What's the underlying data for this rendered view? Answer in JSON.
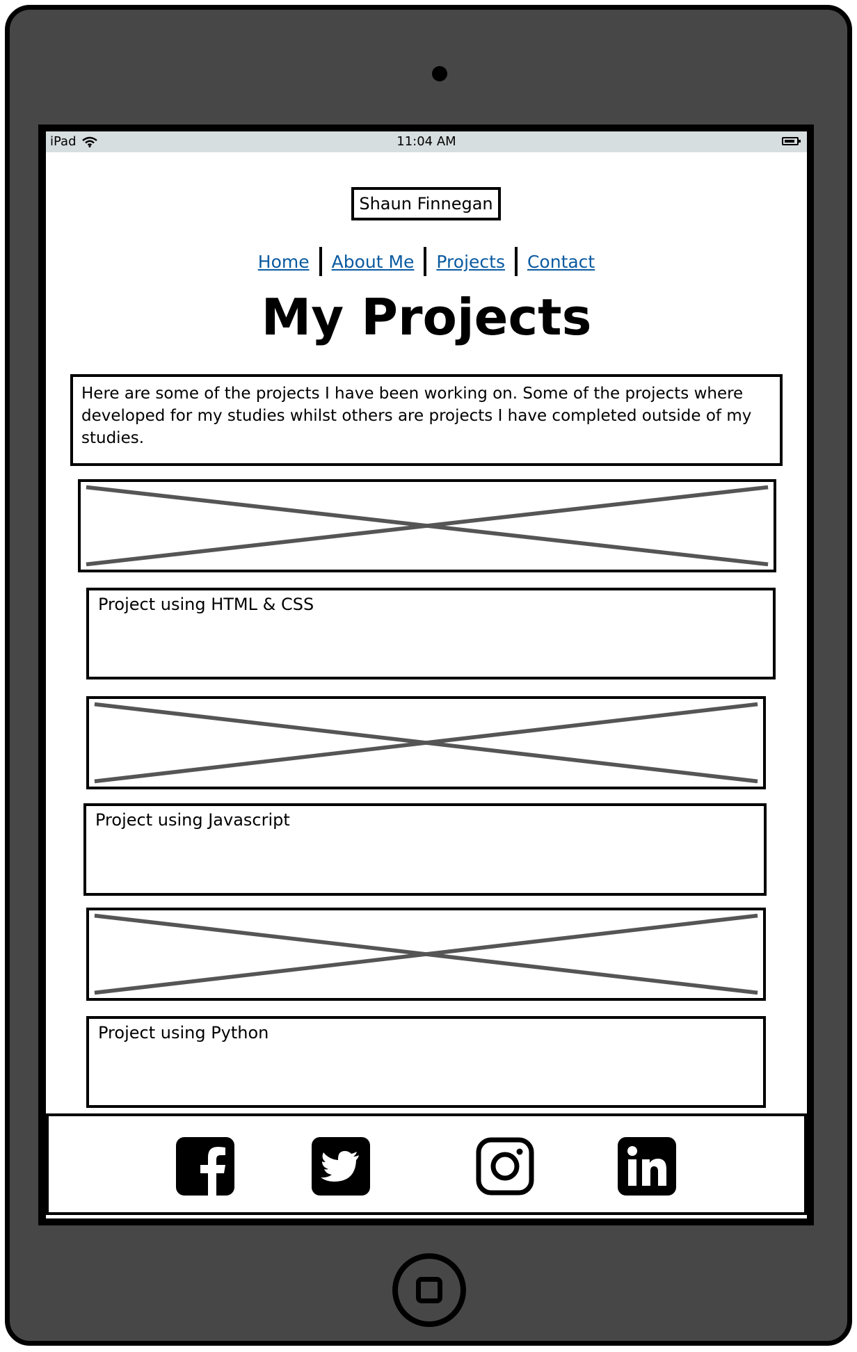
{
  "status_bar": {
    "device": "iPad",
    "time": "11:04 AM"
  },
  "header": {
    "logo_text": "Shaun Finnegan"
  },
  "nav": {
    "items": [
      "Home",
      "About Me",
      "Projects",
      "Contact"
    ]
  },
  "page": {
    "title": "My Projects",
    "intro": "Here are some of the projects I have been working on. Some of the projects where developed for my studies whilst others are projects I have completed outside of my studies."
  },
  "projects": [
    {
      "label": "Project using HTML & CSS"
    },
    {
      "label": "Project using Javascript"
    },
    {
      "label": "Project using Python"
    }
  ],
  "footer": {
    "icons": [
      "facebook-icon",
      "twitter-icon",
      "instagram-icon",
      "linkedin-icon"
    ]
  },
  "colors": {
    "device": "#474747",
    "status_bar": "#d7dee0",
    "link": "#0a5aa0",
    "placeholder_x": "#555555"
  }
}
